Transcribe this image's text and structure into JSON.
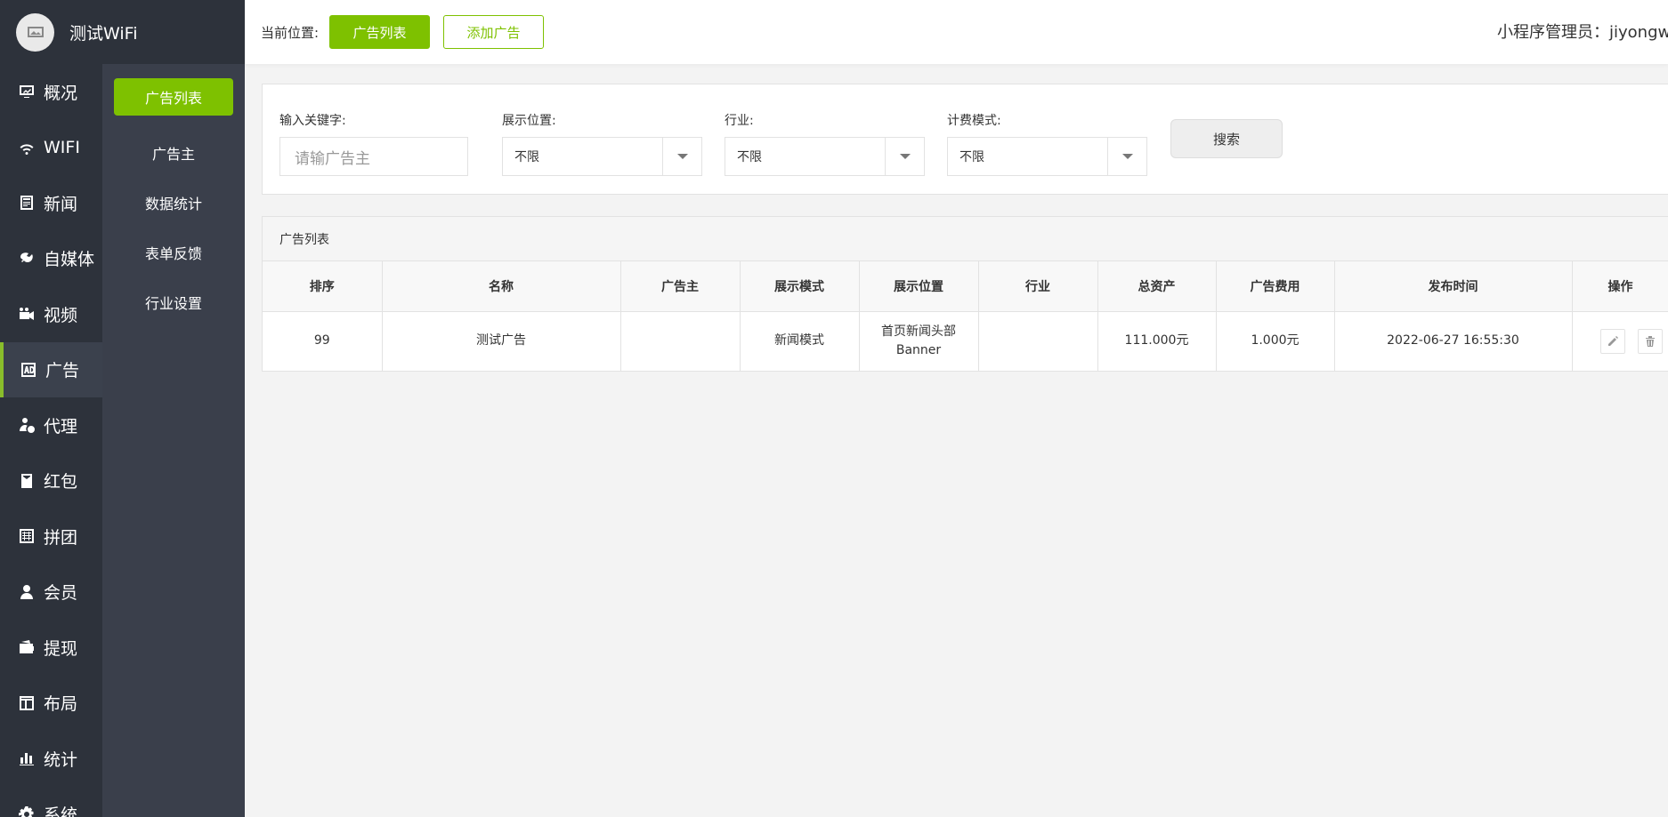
{
  "brand": {
    "name": "测试WiFi"
  },
  "nav": [
    {
      "label": "概况",
      "icon": "dashboard-icon"
    },
    {
      "label": "WIFI",
      "icon": "wifi-icon"
    },
    {
      "label": "新闻",
      "icon": "news-icon"
    },
    {
      "label": "自媒体",
      "icon": "media-icon"
    },
    {
      "label": "视频",
      "icon": "video-icon"
    },
    {
      "label": "广告",
      "icon": "ad-icon",
      "active": true
    },
    {
      "label": "代理",
      "icon": "agent-icon"
    },
    {
      "label": "红包",
      "icon": "red-packet-icon"
    },
    {
      "label": "拼团",
      "icon": "group-buy-icon"
    },
    {
      "label": "会员",
      "icon": "member-icon"
    },
    {
      "label": "提现",
      "icon": "wallet-icon"
    },
    {
      "label": "布局",
      "icon": "layout-icon"
    },
    {
      "label": "统计",
      "icon": "stats-icon"
    },
    {
      "label": "系统",
      "icon": "settings-icon"
    }
  ],
  "subnav": [
    {
      "label": "广告列表",
      "active": true
    },
    {
      "label": "广告主"
    },
    {
      "label": "数据统计"
    },
    {
      "label": "表单反馈"
    },
    {
      "label": "行业设置"
    }
  ],
  "topbar": {
    "crumb_label": "当前位置:",
    "current_button": "广告列表",
    "add_button": "添加广告",
    "admin_text": "小程序管理员：jiyongwei"
  },
  "filter": {
    "keyword_label": "输入关键字:",
    "keyword_placeholder": "请输广告主",
    "position_label": "展示位置:",
    "position_value": "不限",
    "industry_label": "行业:",
    "industry_value": "不限",
    "billing_label": "计费模式:",
    "billing_value": "不限",
    "search_button": "搜索"
  },
  "table": {
    "title": "广告列表",
    "columns": [
      "排序",
      "名称",
      "广告主",
      "展示模式",
      "展示位置",
      "行业",
      "总资产",
      "广告费用",
      "发布时间",
      "操作"
    ],
    "rows": [
      {
        "sort": "99",
        "name": "测试广告",
        "advertiser": "",
        "mode": "新闻模式",
        "position_line1": "首页新闻头部",
        "position_line2": "Banner",
        "industry": "",
        "assets": "111.000元",
        "fee": "1.000元",
        "published": "2022-06-27 16:55:30"
      }
    ]
  },
  "colors": {
    "accent": "#7ec100",
    "sidebar": "#2d323b",
    "subnav": "#3a3f4b"
  }
}
